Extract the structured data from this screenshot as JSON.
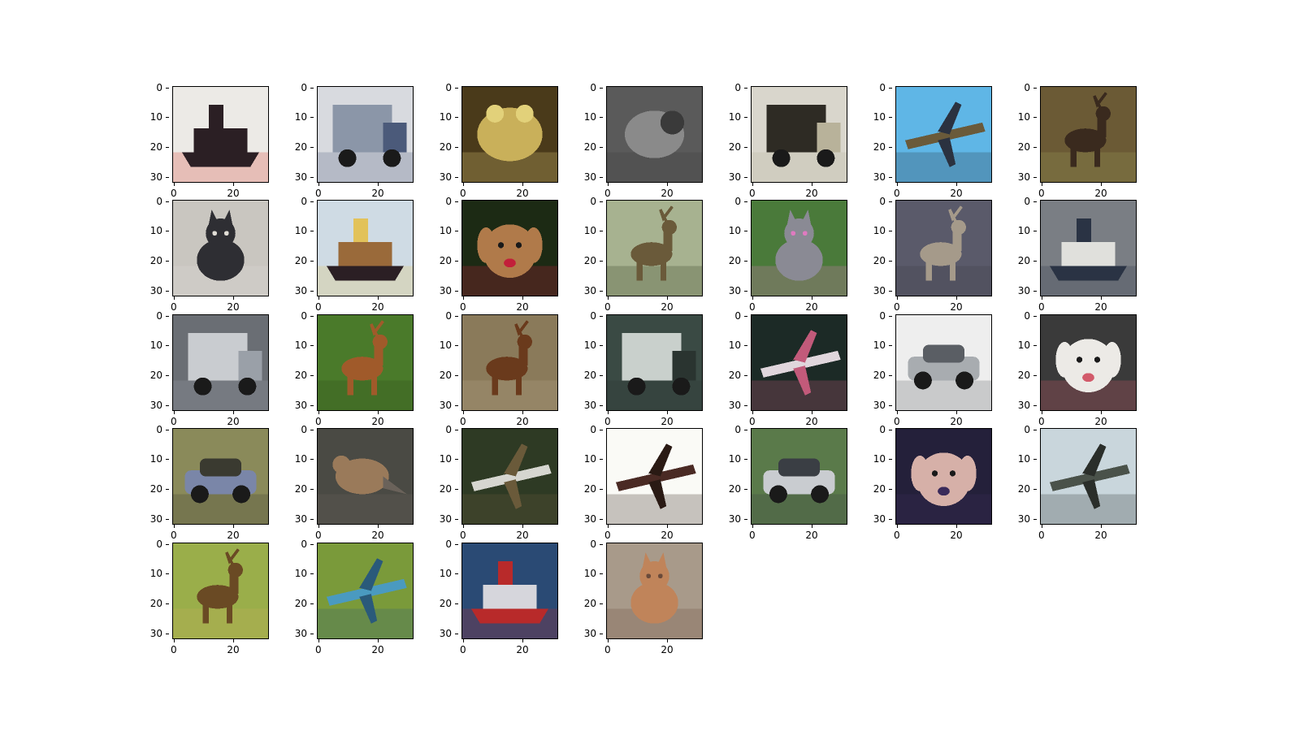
{
  "figure": {
    "grid": {
      "rows": 5,
      "cols": 7,
      "image_size": 32
    },
    "axes": {
      "xticks": [
        "0",
        "20"
      ],
      "yticks": [
        "0",
        "10",
        "20",
        "30"
      ]
    },
    "images": [
      {
        "subject": "tugboat",
        "bg": "#eceae6",
        "fg": "#2b1f24",
        "accent": "#d23a2a"
      },
      {
        "subject": "truck",
        "bg": "#d8dadf",
        "fg": "#8b96a8",
        "accent": "#4b5a7a"
      },
      {
        "subject": "frog",
        "bg": "#4a3a1a",
        "fg": "#c9b05a",
        "accent": "#e2d17a"
      },
      {
        "subject": "animal-gray",
        "bg": "#5a5a5a",
        "fg": "#8a8a8a",
        "accent": "#3a3a3a"
      },
      {
        "subject": "truck",
        "bg": "#d9d6cc",
        "fg": "#2e2b24",
        "accent": "#b8b29a"
      },
      {
        "subject": "airplane",
        "bg": "#5fb6e6",
        "fg": "#6a5a3a",
        "accent": "#2b3240"
      },
      {
        "subject": "deer",
        "bg": "#6b5a35",
        "fg": "#3a2a1e",
        "accent": "#9aa05a"
      },
      {
        "subject": "cat",
        "bg": "#c9c6c0",
        "fg": "#2e2e33",
        "accent": "#e0ddd6"
      },
      {
        "subject": "boat",
        "bg": "#cfdbe4",
        "fg": "#9a6a3a",
        "accent": "#e2c25a"
      },
      {
        "subject": "dog",
        "bg": "#1c2a14",
        "fg": "#b07a4a",
        "accent": "#c21f3a"
      },
      {
        "subject": "deer",
        "bg": "#a7b290",
        "fg": "#6a5a3a",
        "accent": "#2f3a1c"
      },
      {
        "subject": "cat",
        "bg": "#4a7a3a",
        "fg": "#8a8a94",
        "accent": "#e07ac0"
      },
      {
        "subject": "deer",
        "bg": "#5a5a6a",
        "fg": "#a59a8a",
        "accent": "#3a3a45"
      },
      {
        "subject": "ship",
        "bg": "#7a7e84",
        "fg": "#e0e0dc",
        "accent": "#2a3344"
      },
      {
        "subject": "truck",
        "bg": "#6a6e74",
        "fg": "#c9ccd0",
        "accent": "#9aa0a8"
      },
      {
        "subject": "deer",
        "bg": "#4a7a2a",
        "fg": "#a05a2a",
        "accent": "#2e4a1c"
      },
      {
        "subject": "deer",
        "bg": "#8a7a5a",
        "fg": "#6a3a1c",
        "accent": "#b8a88a"
      },
      {
        "subject": "truck",
        "bg": "#3a4a44",
        "fg": "#c9d0cc",
        "accent": "#2a3430"
      },
      {
        "subject": "airplane",
        "bg": "#1c2a26",
        "fg": "#e0d6dc",
        "accent": "#c25a7a"
      },
      {
        "subject": "car",
        "bg": "#eeeeee",
        "fg": "#a8acb0",
        "accent": "#5a5e64"
      },
      {
        "subject": "dog",
        "bg": "#3a3a3a",
        "fg": "#eceae6",
        "accent": "#d25a6a"
      },
      {
        "subject": "car",
        "bg": "#8a8a5a",
        "fg": "#7a86a8",
        "accent": "#3a3a30"
      },
      {
        "subject": "bird",
        "bg": "#4a4a44",
        "fg": "#9a7a5a",
        "accent": "#6a625a"
      },
      {
        "subject": "airplane",
        "bg": "#2e3a24",
        "fg": "#d6d6d0",
        "accent": "#6a5a3a"
      },
      {
        "subject": "airplane",
        "bg": "#fafaf6",
        "fg": "#4a2a24",
        "accent": "#2a1a14"
      },
      {
        "subject": "car",
        "bg": "#5a7a4a",
        "fg": "#c9ccd0",
        "accent": "#3a3e44"
      },
      {
        "subject": "dog",
        "bg": "#24203a",
        "fg": "#d6b0a8",
        "accent": "#3a2a5a"
      },
      {
        "subject": "airplane",
        "bg": "#c9d6dc",
        "fg": "#4a524a",
        "accent": "#2a2e2a"
      },
      {
        "subject": "deer",
        "bg": "#9aae4a",
        "fg": "#6a4a24",
        "accent": "#c9b05a"
      },
      {
        "subject": "airplane",
        "bg": "#7a9a3a",
        "fg": "#4a9ac0",
        "accent": "#2a5a7a"
      },
      {
        "subject": "ship",
        "bg": "#2a4a74",
        "fg": "#d6d6dc",
        "accent": "#b82a2a"
      },
      {
        "subject": "cat",
        "bg": "#a89a8a",
        "fg": "#c0845a",
        "accent": "#6a4a3a"
      }
    ]
  }
}
